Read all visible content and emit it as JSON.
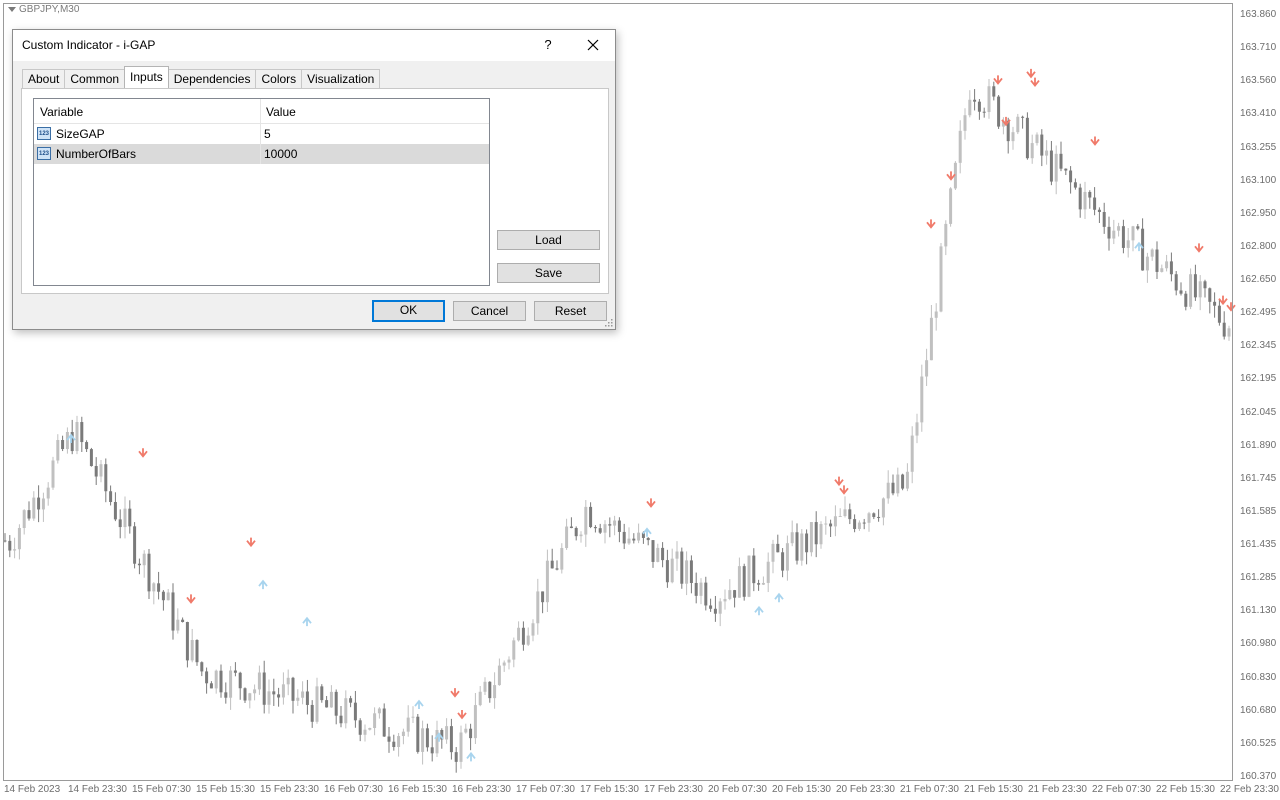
{
  "chart": {
    "symbol_label": "GBPJPY,M30",
    "price_labels": [
      "163.860",
      "163.710",
      "163.560",
      "163.410",
      "163.255",
      "163.100",
      "162.950",
      "162.800",
      "162.650",
      "162.495",
      "162.345",
      "162.195",
      "162.045",
      "161.890",
      "161.745",
      "161.585",
      "161.435",
      "161.285",
      "161.130",
      "160.980",
      "160.830",
      "160.680",
      "160.525",
      "160.370"
    ],
    "time_labels": [
      "14 Feb 2023",
      "14 Feb 23:30",
      "15 Feb 07:30",
      "15 Feb 15:30",
      "15 Feb 23:30",
      "16 Feb 07:30",
      "16 Feb 15:30",
      "16 Feb 23:30",
      "17 Feb 07:30",
      "17 Feb 15:30",
      "17 Feb 23:30",
      "20 Feb 07:30",
      "20 Feb 15:30",
      "20 Feb 23:30",
      "21 Feb 07:30",
      "21 Feb 15:30",
      "21 Feb 23:30",
      "22 Feb 07:30",
      "22 Feb 15:30",
      "22 Feb 23:30"
    ],
    "colors": {
      "up_candle": "#c0c0c0",
      "down_candle": "#7a7a7a",
      "up_arrow": "#a8d4ee",
      "down_arrow": "#f07a6a"
    }
  },
  "chart_data": {
    "type": "candlestick",
    "ylim": [
      160.37,
      163.86
    ],
    "key_points": [
      {
        "time": "14 Feb 2023",
        "price": 161.45
      },
      {
        "time": "14 Feb 23:30",
        "price": 161.95
      },
      {
        "time": "15 Feb 15:30",
        "price": 160.85
      },
      {
        "time": "16 Feb 23:30",
        "price": 160.5
      },
      {
        "time": "17 Feb 15:30",
        "price": 161.6
      },
      {
        "time": "20 Feb 07:30",
        "price": 161.2
      },
      {
        "time": "21 Feb 07:30",
        "price": 161.7
      },
      {
        "time": "21 Feb 15:30",
        "price": 163.55
      },
      {
        "time": "22 Feb 07:30",
        "price": 162.95
      },
      {
        "time": "22 Feb 23:30",
        "price": 162.45
      }
    ]
  },
  "dialog": {
    "title": "Custom Indicator - i-GAP",
    "help_label": "?",
    "tabs": [
      "About",
      "Common",
      "Inputs",
      "Dependencies",
      "Colors",
      "Visualization"
    ],
    "active_tab": "Inputs",
    "table": {
      "columns": [
        "Variable",
        "Value"
      ],
      "rows": [
        {
          "icon": "123",
          "variable": "SizeGAP",
          "value": "5"
        },
        {
          "icon": "123",
          "variable": "NumberOfBars",
          "value": "10000"
        }
      ]
    },
    "buttons": {
      "load": "Load",
      "save": "Save",
      "ok": "OK",
      "cancel": "Cancel",
      "reset": "Reset"
    }
  }
}
